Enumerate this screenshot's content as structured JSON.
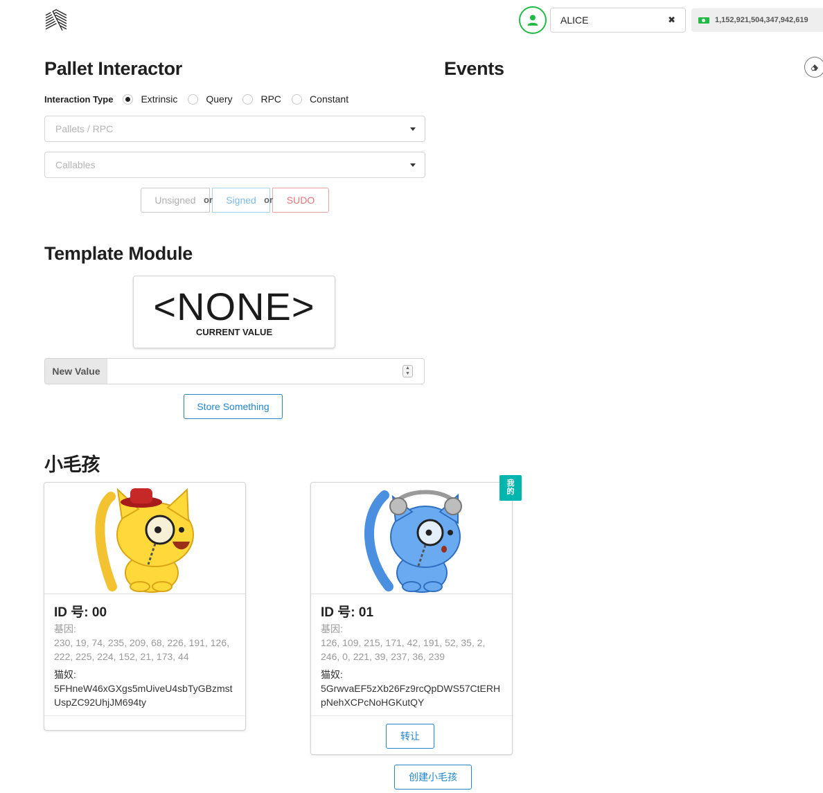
{
  "header": {
    "account_name": "ALICE",
    "clear_symbol": "✖",
    "balance": "1,152,921,504,347,942,619"
  },
  "pallet": {
    "title": "Pallet Interactor",
    "interaction_label": "Interaction Type",
    "types": [
      "Extrinsic",
      "Query",
      "RPC",
      "Constant"
    ],
    "selected_type": "Extrinsic",
    "pallet_placeholder": "Pallets / RPC",
    "callable_placeholder": "Callables",
    "unsigned_label": "Unsigned",
    "signed_label": "Signed",
    "sudo_label": "SUDO",
    "or_label": "or"
  },
  "events": {
    "title": "Events"
  },
  "template": {
    "title": "Template Module",
    "current_value": "<NONE>",
    "current_value_label": "CURRENT VALUE",
    "new_value_label": "New Value",
    "store_button": "Store Something"
  },
  "kitties": {
    "title": "小毛孩",
    "mine_tag": "我的",
    "gene_label": "基因:",
    "owner_label": "猫奴:",
    "transfer_button": "转让",
    "create_button": "创建小毛孩",
    "items": [
      {
        "id_label": "ID 号: 00",
        "genes": "230, 19, 74, 235, 209, 68, 226, 191, 126, 222, 225, 224, 152, 21, 173, 44",
        "owner": "5FHneW46xGXgs5mUiveU4sbTyGBzmstUspZC92UhjJM694ty"
      },
      {
        "id_label": "ID 号: 01",
        "genes": "126, 109, 215, 171, 42, 191, 52, 35, 2, 246, 0, 221, 39, 237, 36, 239",
        "owner": "5GrwvaEF5zXb26Fz9rcQpDWS57CtERHpNehXCPcNoHGKutQY"
      }
    ]
  },
  "colors": {
    "accent_green": "#21ba45",
    "primary_blue": "#2185d0",
    "teal": "#00b5ad",
    "signed_blue": "#7dbbe8",
    "sudo_red": "#e57373"
  }
}
